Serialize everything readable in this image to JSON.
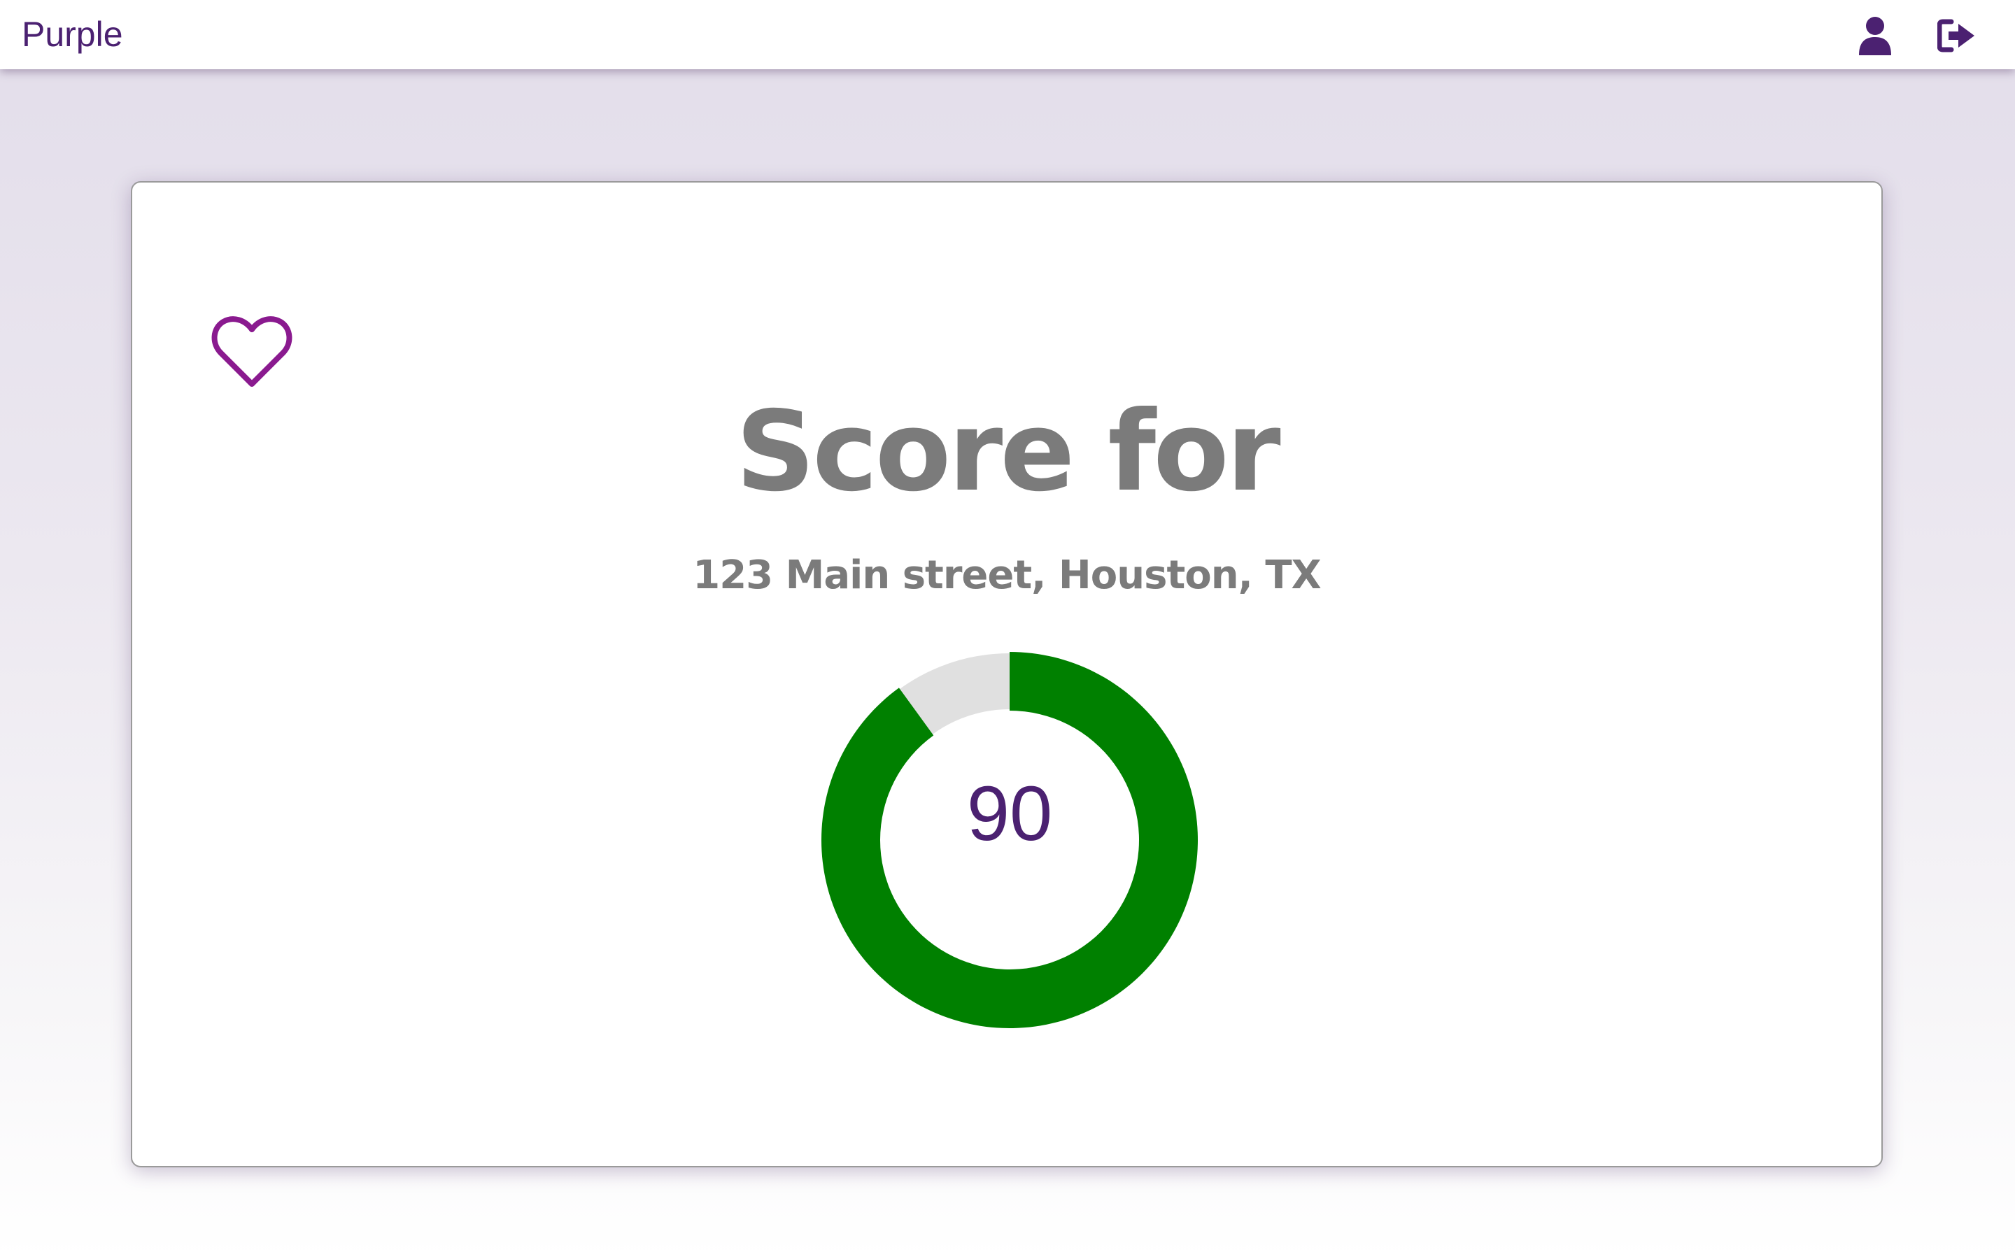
{
  "app": {
    "brand": "Purple"
  },
  "header": {
    "icons": [
      "user-icon",
      "logout-icon"
    ]
  },
  "colors": {
    "brand": "#4b2171",
    "heart": "#8a1a8f",
    "gauge_fill": "#008000",
    "gauge_track": "#e0e0e0",
    "heading_text": "#7b7b7b"
  },
  "score_card": {
    "favorite_icon": "heart-outline-icon",
    "title": "Score for",
    "address": "123 Main street, Houston, TX",
    "score": {
      "value": "90",
      "fraction": 0.9
    }
  }
}
